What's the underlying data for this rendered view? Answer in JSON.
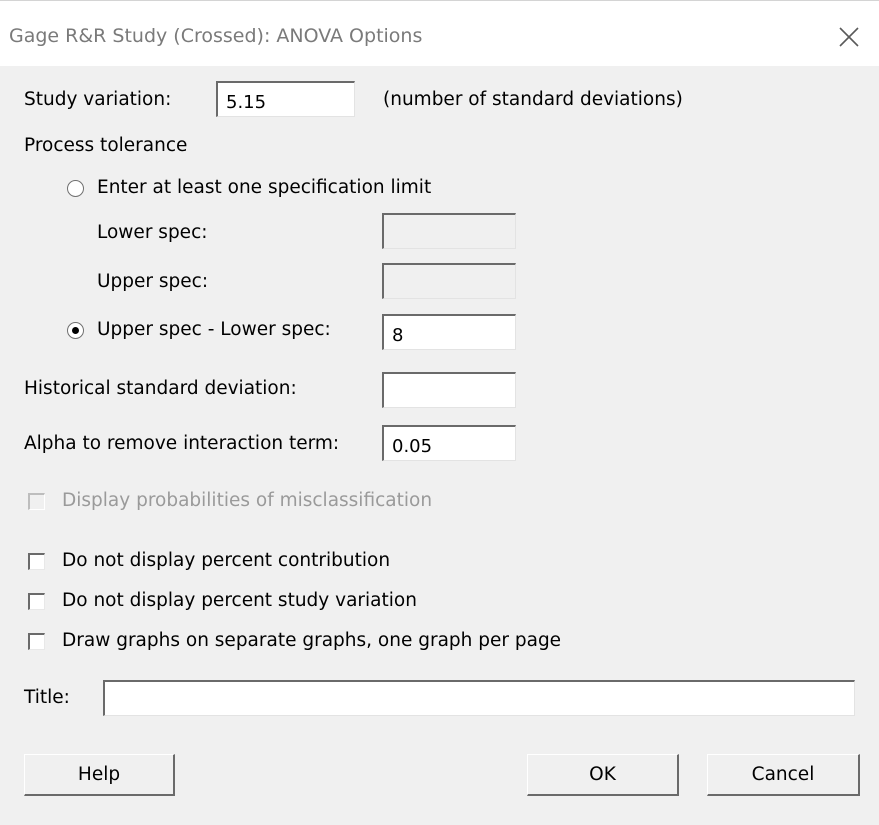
{
  "window": {
    "title": "Gage R&R Study (Crossed): ANOVA Options"
  },
  "study_variation": {
    "label": "Study variation:",
    "value": "5.15",
    "suffix": "(number of standard deviations)"
  },
  "process_tolerance": {
    "label": "Process tolerance",
    "option_spec_limits": {
      "label": "Enter at least one specification limit",
      "selected": false
    },
    "lower_spec": {
      "label": "Lower spec:",
      "value": ""
    },
    "upper_spec": {
      "label": "Upper spec:",
      "value": ""
    },
    "option_range": {
      "label": "Upper spec - Lower spec:",
      "selected": true,
      "value": "8"
    }
  },
  "historical_std": {
    "label": "Historical standard deviation:",
    "value": ""
  },
  "alpha": {
    "label": "Alpha to remove interaction term:",
    "value": "0.05"
  },
  "checkboxes": {
    "misclassification": {
      "label": "Display probabilities of misclassification",
      "checked": false,
      "enabled": false
    },
    "percent_contribution": {
      "label": "Do not display percent contribution",
      "checked": false
    },
    "percent_study_variation": {
      "label": "Do not display percent study variation",
      "checked": false
    },
    "separate_graphs": {
      "label": "Draw graphs on separate graphs, one graph per page",
      "checked": false
    }
  },
  "title_field": {
    "label": "Title:",
    "value": ""
  },
  "buttons": {
    "help": "Help",
    "ok": "OK",
    "cancel": "Cancel"
  },
  "icons": {
    "close": "close-icon"
  }
}
